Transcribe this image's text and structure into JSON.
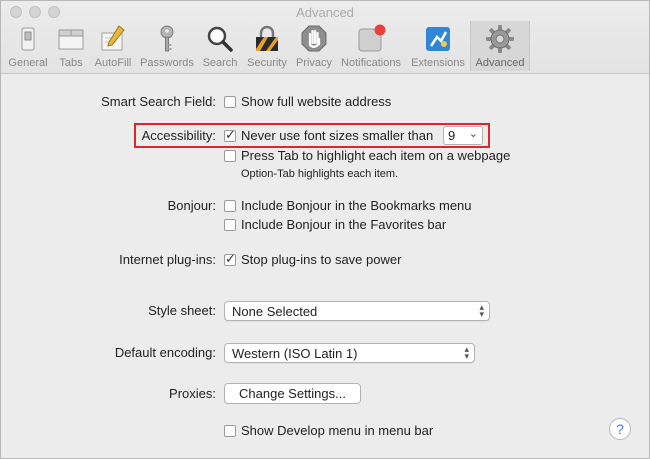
{
  "window": {
    "title": "Advanced"
  },
  "toolbar": {
    "tabs": [
      {
        "label": "General",
        "icon": "general-switch-icon"
      },
      {
        "label": "Tabs",
        "icon": "tabs-icon"
      },
      {
        "label": "AutoFill",
        "icon": "autofill-pencil-icon"
      },
      {
        "label": "Passwords",
        "icon": "key-icon"
      },
      {
        "label": "Search",
        "icon": "magnifier-icon"
      },
      {
        "label": "Security",
        "icon": "padlock-icon"
      },
      {
        "label": "Privacy",
        "icon": "hand-icon"
      },
      {
        "label": "Notifications",
        "icon": "notifications-icon"
      },
      {
        "label": "Extensions",
        "icon": "puzzle-icon"
      },
      {
        "label": "Advanced",
        "icon": "gear-icon",
        "active": true
      }
    ]
  },
  "settings": {
    "smart_search": {
      "label": "Smart Search Field:",
      "option": "Show full website address",
      "checked": false
    },
    "accessibility": {
      "label": "Accessibility:",
      "option1": "Never use font sizes smaller than",
      "option1_checked": true,
      "font_size": "9",
      "option2": "Press Tab to highlight each item on a webpage",
      "option2_checked": false,
      "note": "Option-Tab highlights each item."
    },
    "bonjour": {
      "label": "Bonjour:",
      "option1": "Include Bonjour in the Bookmarks menu",
      "option2": "Include Bonjour in the Favorites bar"
    },
    "plugins": {
      "label": "Internet plug-ins:",
      "option": "Stop plug-ins to save power",
      "checked": true
    },
    "style_sheet": {
      "label": "Style sheet:",
      "value": "None Selected"
    },
    "encoding": {
      "label": "Default encoding:",
      "value": "Western (ISO Latin 1)"
    },
    "proxies": {
      "label": "Proxies:",
      "button": "Change Settings..."
    },
    "develop": {
      "option": "Show Develop menu in menu bar",
      "checked": false
    }
  },
  "help": {
    "glyph": "?"
  },
  "colors": {
    "highlight": "#e0262d",
    "accent": "#3d7bd9"
  }
}
